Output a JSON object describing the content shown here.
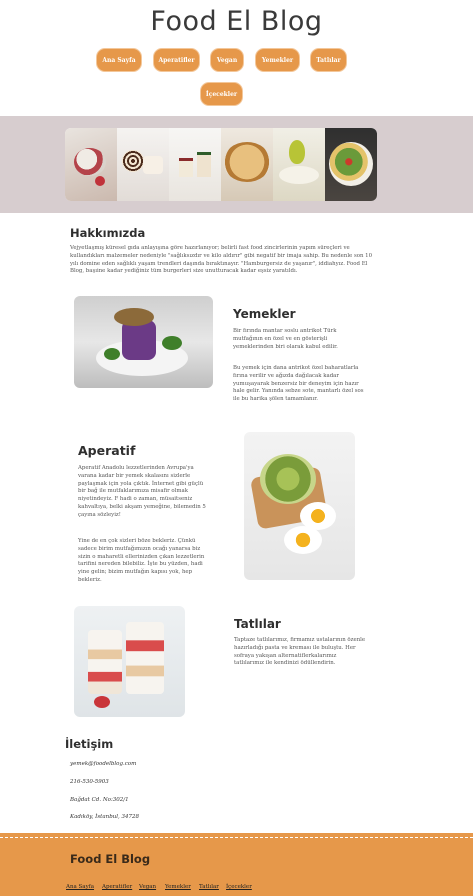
{
  "site": {
    "title": "Food El Blog"
  },
  "nav": [
    {
      "label": "Ana Sayfa"
    },
    {
      "label": "Aperatifler"
    },
    {
      "label": "Vegan"
    },
    {
      "label": "Yemekler"
    },
    {
      "label": "Tatlılar"
    },
    {
      "label": "İçecekler"
    }
  ],
  "about": {
    "heading": "Hakkımızda",
    "text": "Vejyetlaşmış küresel gıda anlayışına göre hazırlanıyor; belirli fast food zincirlerinin yapım süreçleri ve kullandıkları malzemeler nedeniyle \"sağlıksızdır ve kilo aldırır\" gibi negatif bir imaja sahip. Bu nedenle son 10 yılı domine eden sağlıklı yaşam trendleri daşında bıraktınayır. \"Hamburgersiz de yaşanır\", iddiahyız. Food El Blog, başıine kadar yediğiniz tüm burgerleri size unutturacak kadar eşsiz yaratıldı."
  },
  "sections": {
    "yemekler": {
      "heading": "Yemekler",
      "p1": "Bir fırında mantar soslu antrikot Türk mutfağının en özel ve en gösterişli yemeklerinden biri olarak kabul edilir.",
      "p2": "Bu yemek için dana antrikot özel baharatlarla fırına verilir ve ağızda dağılacak kadar yumuşayarak benzersiz bir deneyim için hazır hale gelir. Yanında sebze sote, mantarlı özel sos ile bu harika şölen tamamlanır."
    },
    "aperatif": {
      "heading": "Aperatif",
      "p1": "Aperatif Anadolu lezzetlerinden Avrupa'ya varana kadar bir yemek skalasını sizlerle paylaşmak için yola çıktık. İnternet gibi güçlü bir bağ ile mutfaklarımıza misafir olmak niyetindeyiz. F hadi o zaman, müsaitseniz kahvaltıya, belki akşam yemeğine, bilemedin 5 çayına sözleyiz!",
      "p2": "Yine de en çok sizleri böze bekleriz. Çünkü sadece birim mutfağımızın ocağı yanarsa biz sizin o maharetli ellerinizden çıkan lezzetlerin tarifini nereden bilebiliz. İşte bu yüzden, hadi yine gelin; bizim mutfağın kapısı yok, hep bekleriz."
    },
    "tatlilar": {
      "heading": "Tatlılar",
      "p1": "Taptaze tatlılarımız, firmamız ustalarının özenle hazırladığı pasta ve kreması ile buluştu. Her sofraya yakışan alternatiflerkalarımız tatlılarımız ile kendinizi ödüllendirin."
    }
  },
  "contact": {
    "heading": "İletişim",
    "email": "yemek@foodelblog.com",
    "phone": "216-530-5903",
    "address1": "Bağdat Cd. No:302/1",
    "address2": "Kadıköy, İstanbul, 34728"
  },
  "footer": {
    "title": "Food El Blog",
    "links": [
      {
        "label": "Ana Sayfa"
      },
      {
        "label": "Aperatifler"
      },
      {
        "label": "Vegan"
      },
      {
        "label": "Yemekler"
      },
      {
        "label": "Tatlılar"
      },
      {
        "label": "İçecekler"
      }
    ]
  },
  "colors": {
    "accent": "#e6984a",
    "band": "#d7cdcf",
    "footer": "#e6984a"
  },
  "images": [
    "fruit-bowl-photo",
    "swiss-roll-photo",
    "cake-slices-photo",
    "pie-photo",
    "pear-dessert-photo",
    "salad-bowl-photo",
    "grain-bowl-photo"
  ]
}
